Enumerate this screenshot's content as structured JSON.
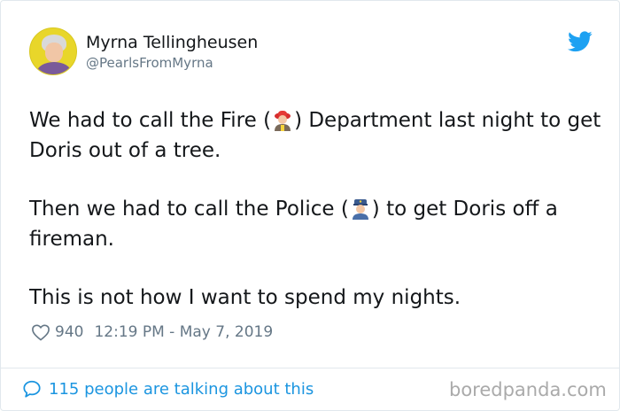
{
  "author": {
    "display_name": "Myrna Tellingheusen",
    "handle": "@PearlsFromMyrna"
  },
  "tweet": {
    "line1_a": "We had to call the Fire (",
    "line1_b": ") Department last night to get Doris out of a tree.",
    "line2_a": "Then we had to call the Police (",
    "line2_b": ") to get Doris off a fireman.",
    "line3": "This is not how I want to spend my nights."
  },
  "meta": {
    "likes": "940",
    "timestamp": "12:19 PM - May 7, 2019"
  },
  "footer": {
    "talking_label": "115 people are talking about this",
    "watermark": "boredpanda.com"
  },
  "icons": {
    "twitter": "twitter-bird-icon",
    "heart": "heart-icon",
    "bubble": "speech-bubble-icon",
    "firefighter": "firefighter-emoji",
    "police": "police-officer-emoji"
  },
  "colors": {
    "accent": "#1b95e0",
    "muted": "#657786",
    "text": "#14171a"
  }
}
